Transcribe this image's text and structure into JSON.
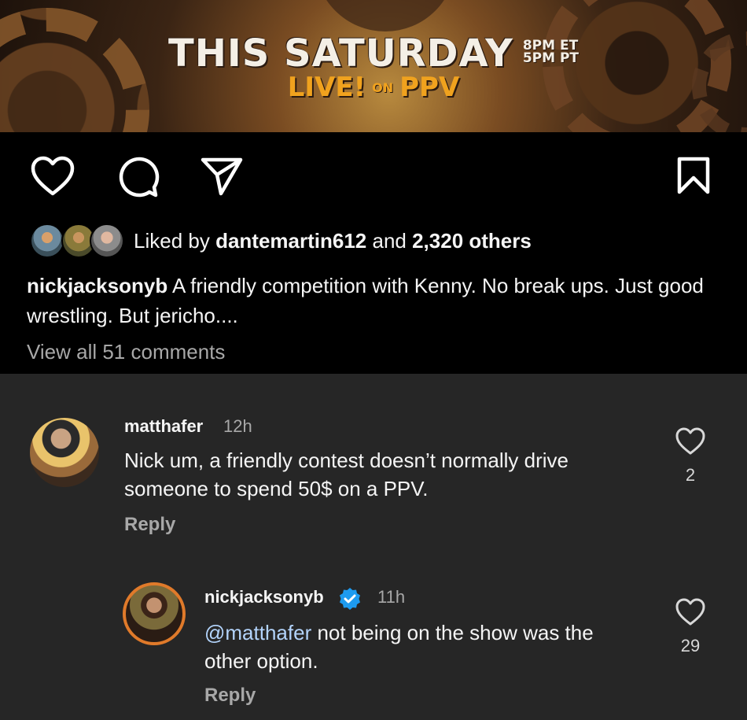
{
  "banner": {
    "headline": "THIS SATURDAY",
    "time_et": "8PM ET",
    "time_pt": "5PM PT",
    "live": "LIVE!",
    "on": "ON",
    "ppv": "PPV"
  },
  "post": {
    "likes": {
      "prefix": "Liked by ",
      "user": "dantemartin612",
      "and": " and ",
      "count": "2,320 others"
    },
    "caption": {
      "username": "nickjacksonyb",
      "text": " A friendly competition with Kenny. No break ups. Just good wrestling. But jericho...."
    },
    "view_all": "View all 51 comments"
  },
  "comments": [
    {
      "username": "matthafer",
      "time": "12h",
      "text_line1": "Nick um, a friendly contest doesn’t normally drive",
      "text_line2": "someone to spend 50$ on a PPV.",
      "reply": "Reply",
      "likes": "2"
    },
    {
      "username": "nickjacksonyb",
      "verified": true,
      "time": "11h",
      "mention": "@matthafer",
      "text_rest": " not being on the show was the",
      "text_line2": "other option.",
      "reply": "Reply",
      "likes": "29"
    }
  ],
  "colors": {
    "accent_orange": "#f0a21e",
    "verified_blue": "#1d9bf0",
    "mention": "#b3d4fc",
    "comment_bg": "#262626"
  }
}
